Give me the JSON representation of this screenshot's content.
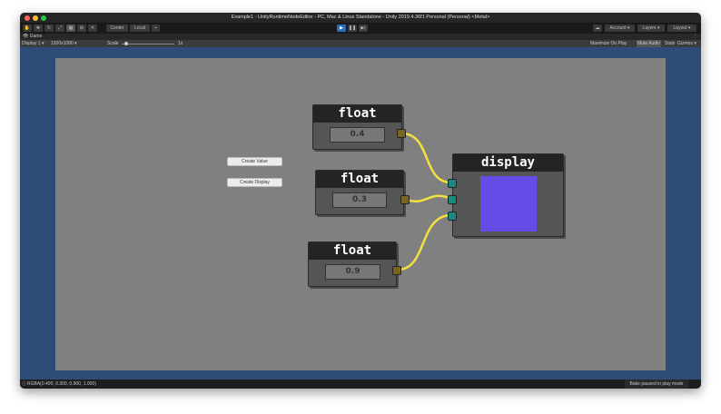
{
  "window": {
    "title": "Example1 - UnityRuntimeNodeEditor - PC, Mac & Linux Standalone - Unity 2019.4.36f1 Personal (Personal) <Metal>"
  },
  "toolbar": {
    "center": "Center",
    "local": "Local",
    "account": "Account ▾",
    "layers": "Layers ▾",
    "layout": "Layout ▾",
    "play": "▶",
    "pause": "❚❚",
    "step": "▶|"
  },
  "game": {
    "tab": "Game",
    "display": "Display 1 ▾",
    "resolution": "1920x1080 ▾",
    "scale_label": "Scale",
    "scale_value": "1x",
    "scale_fraction": 0.0,
    "maximize": "Maximize On Play",
    "mute": "Mute Audio",
    "stats": "Stats",
    "gizmos": "Gizmos ▾"
  },
  "buttons": {
    "create_value": "Create Value",
    "create_display": "Create Display"
  },
  "nodes": [
    {
      "title": "float",
      "value": "0.4"
    },
    {
      "title": "float",
      "value": "0.3"
    },
    {
      "title": "float",
      "value": "0.9"
    }
  ],
  "display": {
    "title": "display",
    "color": "#664ce6"
  },
  "status": {
    "left": "RGBA(0.400, 0.300, 0.900, 1.000)",
    "right": "Bake paused in play mode"
  },
  "colors": {
    "wire": "#f0e040",
    "background": "#2d4d78",
    "view": "#808080"
  }
}
